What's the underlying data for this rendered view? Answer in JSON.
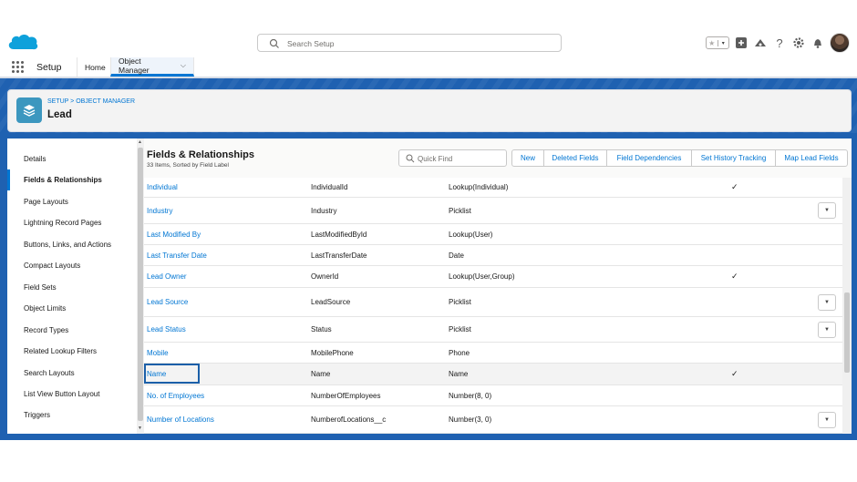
{
  "header": {
    "search_placeholder": "Search Setup",
    "favorites_star": "★",
    "favorites_chevron": "▾",
    "icons": [
      "add-icon",
      "trailhead-icon",
      "help-icon",
      "gear-icon",
      "bell-icon"
    ],
    "help_glyph": "?"
  },
  "nav": {
    "app_name": "Setup",
    "tabs": [
      {
        "label": "Home"
      },
      {
        "label": "Object Manager",
        "selected": true
      }
    ],
    "chevron": "⌵"
  },
  "object_header": {
    "breadcrumb": "SETUP > OBJECT MANAGER",
    "title": "Lead"
  },
  "sidebar": {
    "items": [
      {
        "label": "Details"
      },
      {
        "label": "Fields & Relationships",
        "active": true
      },
      {
        "label": "Page Layouts"
      },
      {
        "label": "Lightning Record Pages"
      },
      {
        "label": "Buttons, Links, and Actions"
      },
      {
        "label": "Compact Layouts"
      },
      {
        "label": "Field Sets"
      },
      {
        "label": "Object Limits"
      },
      {
        "label": "Record Types"
      },
      {
        "label": "Related Lookup Filters"
      },
      {
        "label": "Search Layouts"
      },
      {
        "label": "List View Button Layout"
      },
      {
        "label": "Triggers"
      }
    ]
  },
  "content": {
    "title": "Fields & Relationships",
    "subtitle": "33 Items, Sorted by Field Label",
    "quick_find_placeholder": "Quick Find",
    "buttons": {
      "new": "New",
      "deleted_fields": "Deleted Fields",
      "field_dependencies": "Field Dependencies",
      "set_history_tracking": "Set History Tracking",
      "map_lead_fields": "Map Lead Fields"
    },
    "rows": [
      {
        "label": "Individual",
        "api": "IndividualId",
        "type": "Lookup(Individual)",
        "indexed": "✓",
        "menu": false
      },
      {
        "label": "Industry",
        "api": "Industry",
        "type": "Picklist",
        "indexed": "",
        "menu": true
      },
      {
        "label": "Last Modified By",
        "api": "LastModifiedById",
        "type": "Lookup(User)",
        "indexed": "",
        "menu": false
      },
      {
        "label": "Last Transfer Date",
        "api": "LastTransferDate",
        "type": "Date",
        "indexed": "",
        "menu": false
      },
      {
        "label": "Lead Owner",
        "api": "OwnerId",
        "type": "Lookup(User,Group)",
        "indexed": "✓",
        "menu": false
      },
      {
        "label": "Lead Source",
        "api": "LeadSource",
        "type": "Picklist",
        "indexed": "",
        "menu": true
      },
      {
        "label": "Lead Status",
        "api": "Status",
        "type": "Picklist",
        "indexed": "",
        "menu": true
      },
      {
        "label": "Mobile",
        "api": "MobilePhone",
        "type": "Phone",
        "indexed": "",
        "menu": false
      },
      {
        "label": "Name",
        "api": "Name",
        "type": "Name",
        "indexed": "✓",
        "menu": false,
        "focused": true
      },
      {
        "label": "No. of Employees",
        "api": "NumberOfEmployees",
        "type": "Number(8, 0)",
        "indexed": "",
        "menu": false
      },
      {
        "label": "Number of Locations",
        "api": "NumberofLocations__c",
        "type": "Number(3, 0)",
        "indexed": "",
        "menu": true
      }
    ],
    "menu_glyph": "▼"
  },
  "colors": {
    "brand_blue": "#0176d3",
    "band_blue": "#1f61b1",
    "object_icon": "#3c97bf"
  }
}
